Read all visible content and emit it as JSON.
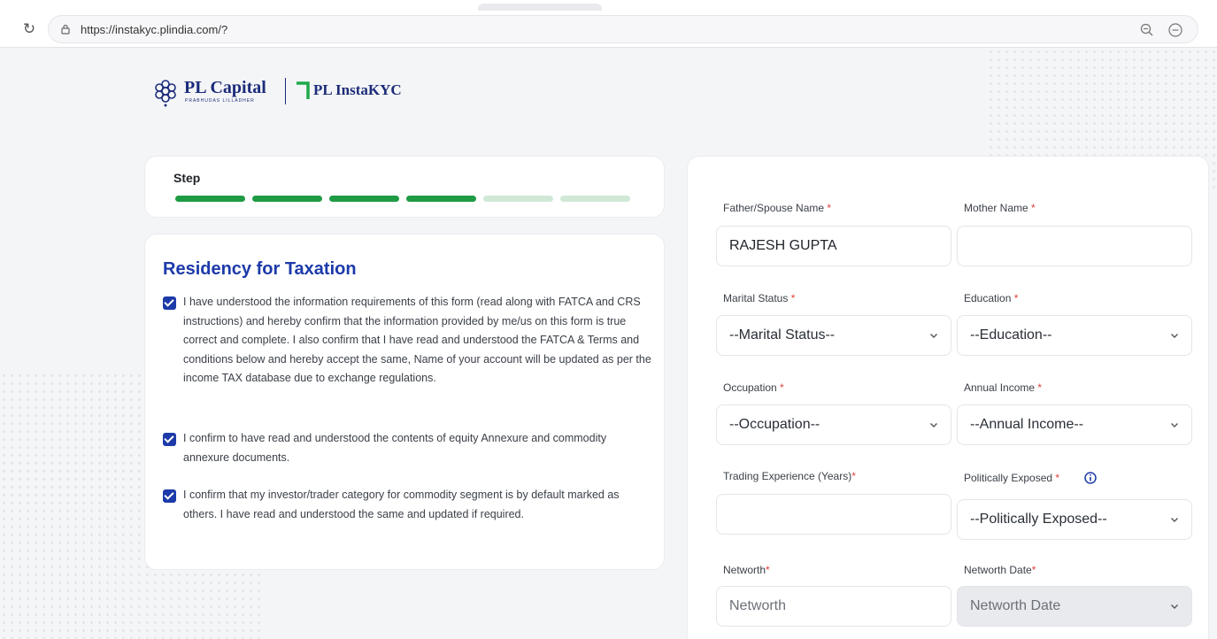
{
  "browser": {
    "url": "https://instakyc.plindia.com/?"
  },
  "brand": {
    "name": "PL Capital",
    "tagline": "PRABHUDAS LILLADHER",
    "product": "PL InstaKYC",
    "color": "#1c2c7a",
    "accent": "#1faa4a"
  },
  "steps": {
    "label": "Step",
    "total": 6,
    "completed": 4,
    "done_color": "#1f9b45",
    "pending_color": "#cfe9d6"
  },
  "residency": {
    "title": "Residency for Taxation",
    "items": [
      {
        "checked": true,
        "text": "I have understood the information requirements of this form (read along with FATCA and CRS instructions) and hereby confirm that the information provided by me/us on this form is true correct and complete. I also confirm that I have read and understood the FATCA & Terms and conditions below and hereby accept the same, Name of your account will be updated as per the income TAX database due to exchange regulations."
      },
      {
        "checked": true,
        "text": "I confirm to have read and understood the contents of equity Annexure and commodity annexure documents."
      },
      {
        "checked": true,
        "text": "I confirm that my investor/trader category for commodity segment is by default marked as others. I have read and understood the same and updated if required."
      }
    ]
  },
  "form": {
    "father_spouse": {
      "label": "Father/Spouse Name",
      "required": "*",
      "value": "RAJESH GUPTA"
    },
    "mother": {
      "label": "Mother Name",
      "required": "*",
      "value": ""
    },
    "marital_status": {
      "label": "Marital Status",
      "required": "*",
      "selected": "--Marital Status--"
    },
    "education": {
      "label": "Education",
      "required": "*",
      "selected": "--Education--"
    },
    "occupation": {
      "label": "Occupation",
      "required": "*",
      "selected": "--Occupation--"
    },
    "annual_income": {
      "label": "Annual Income",
      "required": "*",
      "selected": "--Annual Income--"
    },
    "trading_experience": {
      "label": "Trading Experience (Years)",
      "required": "*",
      "value": ""
    },
    "politically_exposed": {
      "label": "Politically Exposed",
      "required": "*",
      "selected": "--Politically Exposed--"
    },
    "networth": {
      "label": "Networth",
      "required": "*",
      "placeholder": "Networth"
    },
    "networth_date": {
      "label": "Networth Date",
      "required": "*",
      "selected": "Networth Date"
    }
  }
}
